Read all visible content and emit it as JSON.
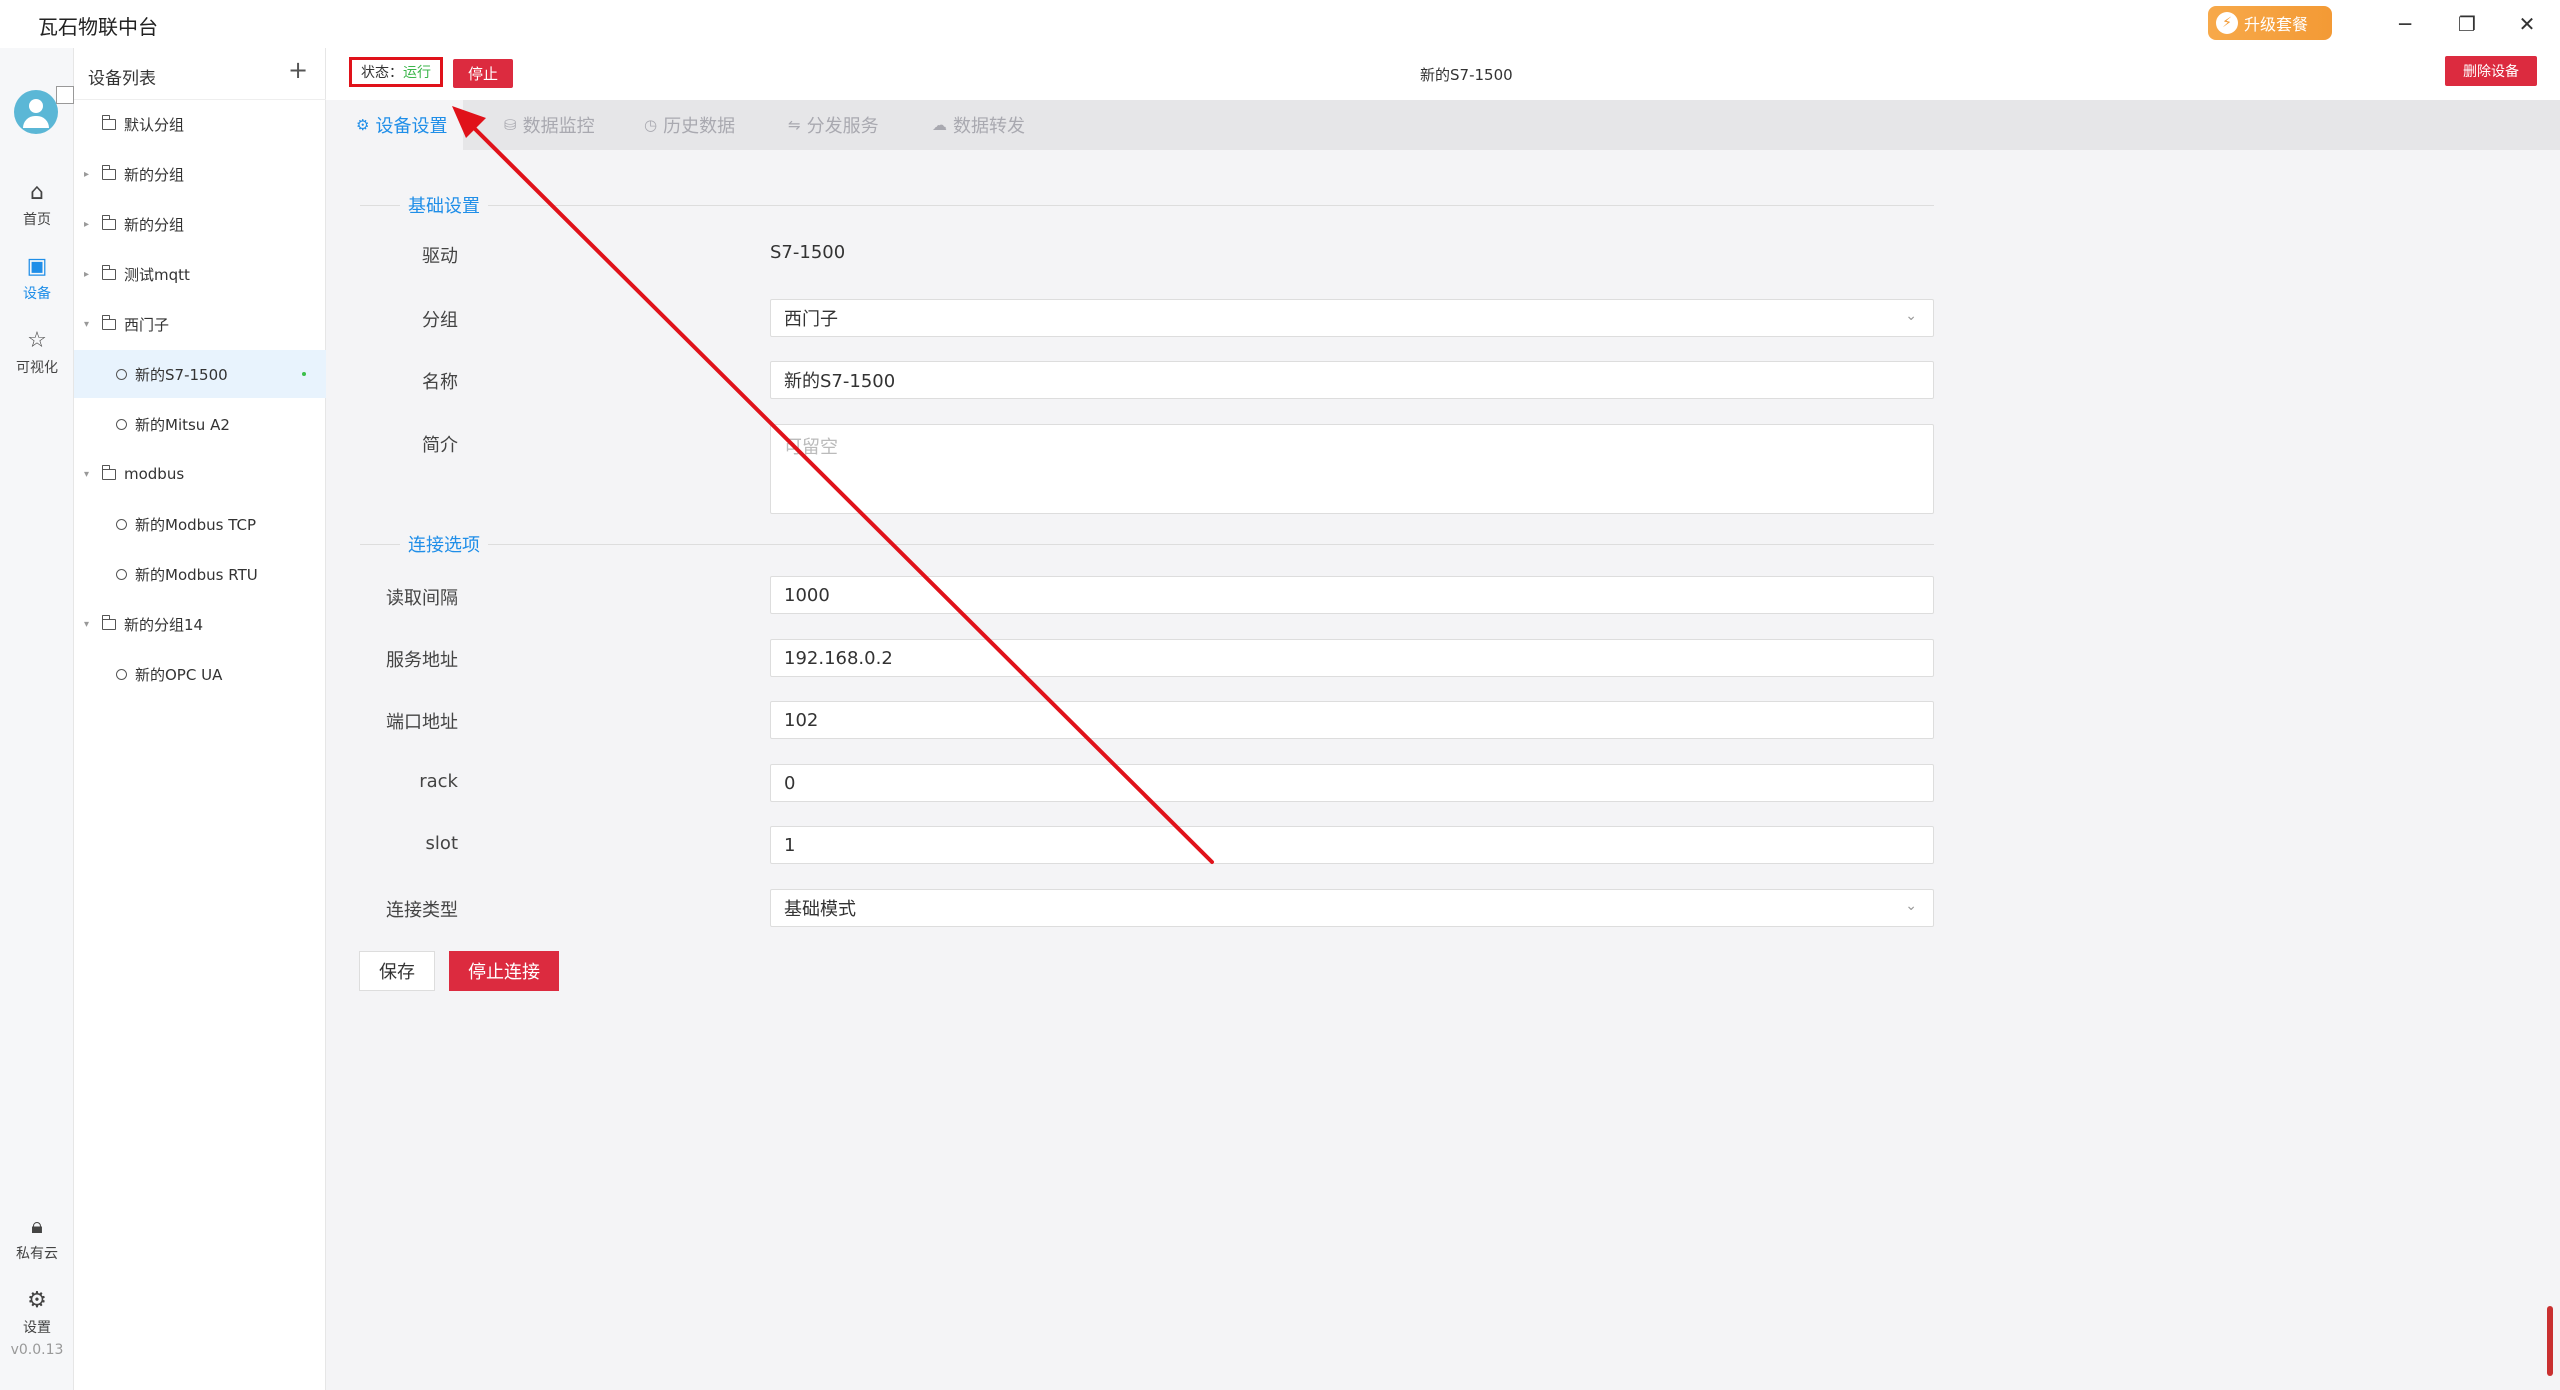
{
  "app": {
    "title": "瓦石物联中台",
    "upgrade_label": "升级套餐",
    "window_controls": [
      "minimize-icon",
      "restore-icon",
      "close-icon"
    ]
  },
  "rail": {
    "items": [
      {
        "icon": "home-icon",
        "label": "首页",
        "active": false
      },
      {
        "icon": "chip-icon",
        "label": "设备",
        "active": true
      },
      {
        "icon": "star-icon",
        "label": "可视化",
        "active": false
      },
      {
        "icon": "lock-icon",
        "label": "私有云",
        "active": false
      },
      {
        "icon": "gear-icon",
        "label": "设置",
        "active": false
      }
    ],
    "version": "v0.0.13"
  },
  "device_list": {
    "title": "设备列表",
    "add_icon": "plus-icon",
    "items": [
      {
        "label": "默认分组",
        "kind": "group"
      },
      {
        "label": "新的分组",
        "kind": "group",
        "collapsed": true
      },
      {
        "label": "新的分组",
        "kind": "group",
        "collapsed": true
      },
      {
        "label": "测试mqtt",
        "kind": "group",
        "collapsed": true
      },
      {
        "label": "西门子",
        "kind": "group",
        "expanded": true
      },
      {
        "label": "新的S7-1500",
        "kind": "device",
        "selected": true
      },
      {
        "label": "新的Mitsu A2",
        "kind": "device"
      },
      {
        "label": "modbus",
        "kind": "group",
        "expanded": true
      },
      {
        "label": "新的Modbus TCP",
        "kind": "device"
      },
      {
        "label": "新的Modbus RTU",
        "kind": "device"
      },
      {
        "label": "新的分组14",
        "kind": "group",
        "expanded": true
      },
      {
        "label": "新的OPC UA",
        "kind": "device"
      }
    ]
  },
  "topbar": {
    "status_label": "状态：",
    "status_value": "运行",
    "stop_label": "停止",
    "device_title": "新的S7-1500",
    "delete_label": "删除设备"
  },
  "tabs": [
    {
      "label": "设备设置",
      "active": true
    },
    {
      "label": "数据监控"
    },
    {
      "label": "历史数据"
    },
    {
      "label": "分发服务"
    },
    {
      "label": "数据转发"
    }
  ],
  "form": {
    "basic_section": "基础设置",
    "driver_label": "驱动",
    "driver_value": "S7-1500",
    "group_label": "分组",
    "group_value": "西门子",
    "name_label": "名称",
    "name_value": "新的S7-1500",
    "desc_label": "简介",
    "desc_placeholder": "可留空",
    "conn_section": "连接选项",
    "interval_label": "读取间隔",
    "interval_value": "1000",
    "address_label": "服务地址",
    "address_value": "192.168.0.2",
    "port_label": "端口地址",
    "port_value": "102",
    "rack_label": "rack",
    "rack_value": "0",
    "slot_label": "slot",
    "slot_value": "1",
    "conntype_label": "连接类型",
    "conntype_value": "基础模式",
    "save_label": "保存",
    "stop_conn_label": "停止连接"
  },
  "colors": {
    "accent": "#1f8ee8",
    "danger": "#dc2b3f",
    "status_ok": "#3bb54a",
    "annotation": "#e0121a",
    "upgrade": "#f39a35"
  }
}
